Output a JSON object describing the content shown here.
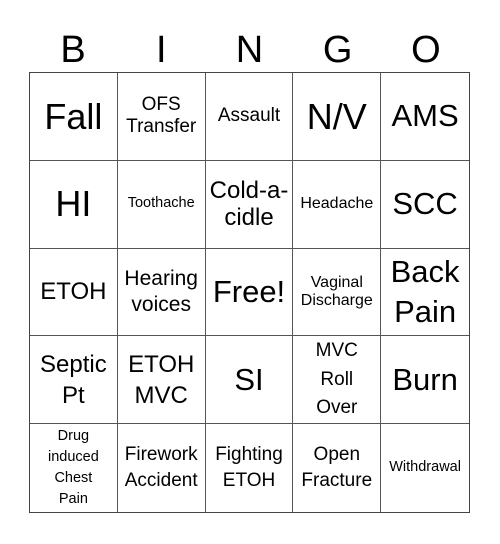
{
  "header": {
    "letters": [
      "B",
      "I",
      "N",
      "G",
      "O"
    ]
  },
  "card": {
    "rows": [
      [
        "Fall",
        "OFS Transfer",
        "Assault",
        "N/V",
        "AMS"
      ],
      [
        "HI",
        "Toothache",
        "Cold-a-cidle",
        "Headache",
        "SCC"
      ],
      [
        "ETOH",
        "Hearing voices",
        "Free!",
        "Vaginal Discharge",
        "Back Pain"
      ],
      [
        "Septic Pt",
        "ETOH MVC",
        "SI",
        "MVC Roll Over",
        "Burn"
      ],
      [
        "Drug induced Chest Pain",
        "Firework Accident",
        "Fighting ETOH",
        "Open Fracture",
        "Withdrawal"
      ]
    ],
    "free_space": "Free!"
  }
}
